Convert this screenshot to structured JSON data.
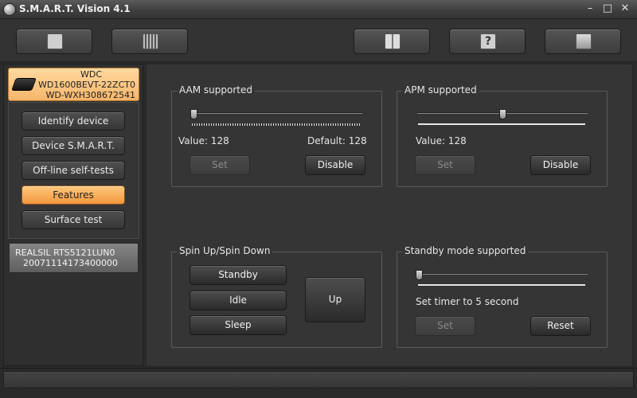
{
  "window": {
    "title": "S.M.A.R.T. Vision 4.1",
    "controls": {
      "minimize": "–",
      "maximize": "□",
      "close": "✕"
    }
  },
  "toolbar": {
    "icons": [
      "save-disk-icon",
      "chip-icon",
      "help-book-icon",
      "question-icon",
      "network-icon"
    ],
    "glyphs": [
      "",
      "",
      "",
      "?",
      ""
    ]
  },
  "device": {
    "vendor": "WDC",
    "model": "WD1600BEVT-22ZCT0",
    "serial": "WD-WXH308672541"
  },
  "nav": {
    "items": [
      "Identify device",
      "Device S.M.A.R.T.",
      "Off-line self-tests",
      "Features",
      "Surface test"
    ],
    "active": "Features"
  },
  "secondary_device": {
    "name": "REALSIL RTS5121LUN0",
    "serial": "20071114173400000"
  },
  "aam": {
    "title": "AAM supported",
    "value_label": "Value: 128",
    "default_label": "Default: 128",
    "slider_fraction": 0.0,
    "set_label": "Set",
    "disable_label": "Disable"
  },
  "apm": {
    "title": "APM supported",
    "value_label": "Value: 128",
    "slider_fraction": 0.5,
    "set_label": "Set",
    "disable_label": "Disable"
  },
  "spin": {
    "title": "Spin Up/Spin Down",
    "standby_label": "Standby",
    "idle_label": "Idle",
    "sleep_label": "Sleep",
    "up_label": "Up"
  },
  "standby": {
    "title": "Standby mode supported",
    "timer_label": "Set timer to 5 second",
    "slider_fraction": 0.0,
    "set_label": "Set",
    "reset_label": "Reset"
  },
  "colors": {
    "accent": "#f6a64e",
    "background": "#2b2b2b",
    "panel": "#353535"
  }
}
